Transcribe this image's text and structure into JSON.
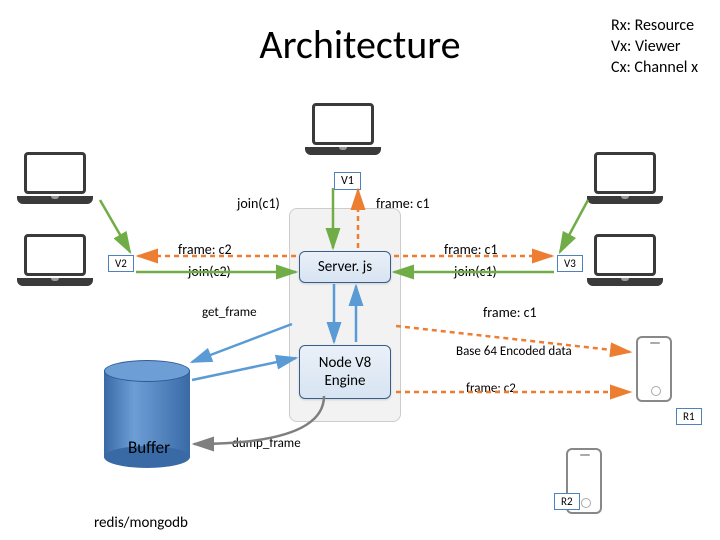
{
  "title": "Architecture",
  "legend": {
    "r": "Rx: Resource",
    "v": "Vx: Viewer",
    "c": "Cx: Channel x"
  },
  "tags": {
    "v1": "V1",
    "v2": "V2",
    "v3": "V3",
    "r1": "R1",
    "r2": "R2"
  },
  "boxes": {
    "server": "Server. js",
    "engine_l1": "Node V8",
    "engine_l2": "Engine"
  },
  "labels": {
    "join_c1": "join(c1)",
    "frame_c1_top": "frame: c1",
    "frame_c2_left": "frame: c2",
    "join_c2": "join(c2)",
    "frame_c1_right1": "frame: c1",
    "join_c1_right": "join(c1)",
    "get_frame": "get_frame",
    "frame_c1_r1": "frame: c1",
    "base64": "Base 64 Encoded data",
    "frame_c2_r1": "frame: c2",
    "dump_frame": "dump_frame",
    "buffer": "Buffer",
    "db": "redis/mongodb"
  }
}
